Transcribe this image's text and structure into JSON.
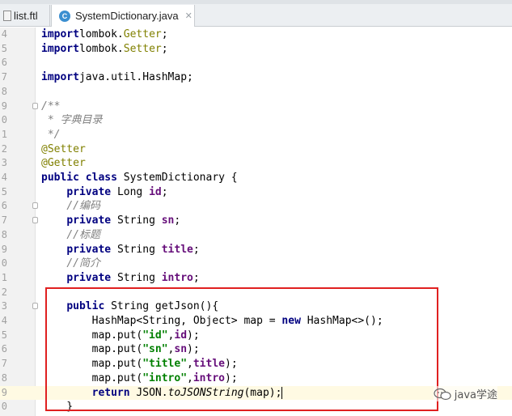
{
  "tabs": [
    {
      "label": "list.ftl",
      "active": false
    },
    {
      "label": "SystemDictionary.java",
      "active": true,
      "icon": "java-class-icon",
      "close": "✕"
    }
  ],
  "lines": [
    {
      "n": "4",
      "c": [
        [
          "kw",
          "import"
        ],
        [
          "",
          "lombok."
        ],
        [
          "pkg-cls",
          "Getter"
        ],
        [
          "",
          ";"
        ]
      ]
    },
    {
      "n": "5",
      "c": [
        [
          "kw",
          "import"
        ],
        [
          "",
          "lombok."
        ],
        [
          "pkg-cls",
          "Setter"
        ],
        [
          "",
          ";"
        ]
      ]
    },
    {
      "n": "6",
      "c": []
    },
    {
      "n": "7",
      "c": [
        [
          "kw",
          "import"
        ],
        [
          "",
          "java.util.HashMap;"
        ]
      ]
    },
    {
      "n": "8",
      "c": []
    },
    {
      "n": "9",
      "c": [
        [
          "cm",
          "/**"
        ]
      ]
    },
    {
      "n": "0",
      "c": [
        [
          "cm",
          " * 字典目录"
        ]
      ]
    },
    {
      "n": "1",
      "c": [
        [
          "cm",
          " */"
        ]
      ]
    },
    {
      "n": "2",
      "c": [
        [
          "ann",
          "@Setter"
        ]
      ]
    },
    {
      "n": "3",
      "c": [
        [
          "ann",
          "@Getter"
        ]
      ]
    },
    {
      "n": "4",
      "c": [
        [
          "kw",
          "public class "
        ],
        [
          "",
          "SystemDictionary {"
        ]
      ]
    },
    {
      "n": "5",
      "c": [
        [
          "",
          "    "
        ],
        [
          "kw",
          "private "
        ],
        [
          "",
          "Long "
        ],
        [
          "fld",
          "id"
        ],
        [
          "",
          ";"
        ]
      ]
    },
    {
      "n": "6",
      "c": [
        [
          "",
          "    "
        ],
        [
          "cm",
          "//编码"
        ]
      ]
    },
    {
      "n": "7",
      "c": [
        [
          "",
          "    "
        ],
        [
          "kw",
          "private "
        ],
        [
          "",
          "String "
        ],
        [
          "fld",
          "sn"
        ],
        [
          "",
          ";"
        ]
      ]
    },
    {
      "n": "8",
      "c": [
        [
          "",
          "    "
        ],
        [
          "cm",
          "//标题"
        ]
      ]
    },
    {
      "n": "9",
      "c": [
        [
          "",
          "    "
        ],
        [
          "kw",
          "private "
        ],
        [
          "",
          "String "
        ],
        [
          "fld",
          "title"
        ],
        [
          "",
          ";"
        ]
      ]
    },
    {
      "n": "0",
      "c": [
        [
          "",
          "    "
        ],
        [
          "cm",
          "//简介"
        ]
      ]
    },
    {
      "n": "1",
      "c": [
        [
          "",
          "    "
        ],
        [
          "kw",
          "private "
        ],
        [
          "",
          "String "
        ],
        [
          "fld",
          "intro"
        ],
        [
          "",
          ";"
        ]
      ]
    },
    {
      "n": "2",
      "c": []
    },
    {
      "n": "3",
      "c": [
        [
          "",
          "    "
        ],
        [
          "kw",
          "public "
        ],
        [
          "",
          "String getJson(){"
        ]
      ]
    },
    {
      "n": "4",
      "c": [
        [
          "",
          "        HashMap<String, Object> map = "
        ],
        [
          "kw",
          "new "
        ],
        [
          "",
          "HashMap<>();"
        ]
      ]
    },
    {
      "n": "5",
      "c": [
        [
          "",
          "        map.put("
        ],
        [
          "str",
          "\"id\""
        ],
        [
          "",
          ","
        ],
        [
          "fld",
          "id"
        ],
        [
          "",
          ");"
        ]
      ]
    },
    {
      "n": "6",
      "c": [
        [
          "",
          "        map.put("
        ],
        [
          "str",
          "\"sn\""
        ],
        [
          "",
          ","
        ],
        [
          "fld",
          "sn"
        ],
        [
          "",
          ");"
        ]
      ]
    },
    {
      "n": "7",
      "c": [
        [
          "",
          "        map.put("
        ],
        [
          "str",
          "\"title\""
        ],
        [
          "",
          ","
        ],
        [
          "fld",
          "title"
        ],
        [
          "",
          ");"
        ]
      ]
    },
    {
      "n": "8",
      "c": [
        [
          "",
          "        map.put("
        ],
        [
          "str",
          "\"intro\""
        ],
        [
          "",
          ","
        ],
        [
          "fld",
          "intro"
        ],
        [
          "",
          ");"
        ]
      ]
    },
    {
      "n": "9",
      "c": [
        [
          "",
          "        "
        ],
        [
          "kw",
          "return "
        ],
        [
          "",
          "JSON."
        ],
        [
          "italic",
          "toJSONString"
        ],
        [
          "",
          "(map);"
        ]
      ],
      "current": true,
      "caret": true
    },
    {
      "n": "0",
      "c": [
        [
          "",
          "    }"
        ]
      ]
    }
  ],
  "watermark": {
    "text": "java学途"
  },
  "colors": {
    "highlight_box": "#e02020",
    "keyword": "#000080",
    "string": "#008000",
    "field": "#660e7a",
    "annotation": "#808000",
    "comment": "#808080"
  }
}
